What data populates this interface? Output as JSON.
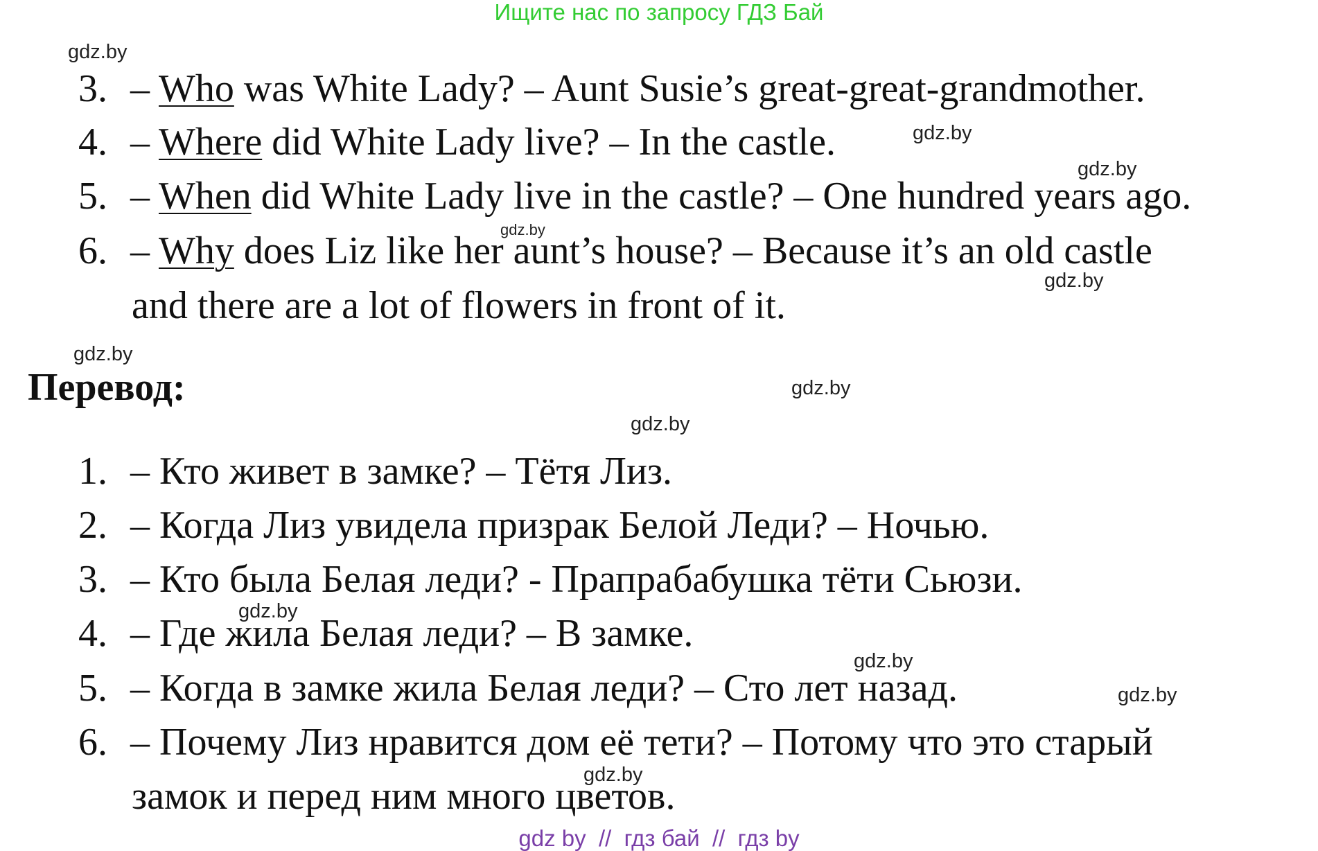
{
  "banner_top": "Ищите нас по запросу ГДЗ Бай",
  "banner_bottom": "gdz by  //  гдз бай  //  гдз by",
  "watermark": "gdz.by",
  "english": [
    {
      "num": "3.",
      "dash": "– ",
      "q": "Who",
      "rest": " was White Lady? – Aunt Susie’s great-great-grandmother."
    },
    {
      "num": "4.",
      "dash": "– ",
      "q": "Where",
      "rest": " did White Lady live? – In the castle."
    },
    {
      "num": "5.",
      "dash": "– ",
      "q": "When",
      "rest": " did White Lady live in the castle? – One hundred years ago."
    },
    {
      "num": "6.",
      "dash": "– ",
      "q": "Why",
      "rest": " does Liz like her aunt’s house? – Because it’s an old castle",
      "cont": "and there are a lot of flowers in front of it."
    }
  ],
  "heading": "Перевод:",
  "russian": [
    {
      "num": "1.",
      "text": "– Кто живет в замке? – Тётя Лиз."
    },
    {
      "num": "2.",
      "text": "– Когда Лиз увидела призрак Белой Леди? – Ночью."
    },
    {
      "num": "3.",
      "text": "– Кто была Белая леди? - Прапрабабушка тёти Сьюзи."
    },
    {
      "num": "4.",
      "text": "– Где жила Белая леди? – В замке."
    },
    {
      "num": "5.",
      "text": "– Когда в замке жила Белая леди? – Сто лет назад."
    },
    {
      "num": "6.",
      "text": "– Почему Лиз нравится дом её тети? – Потому что это старый",
      "cont": "замок и перед ним много цветов."
    }
  ],
  "colors": {
    "banner_top": "#33cc33",
    "banner_bottom": "#7a3fa8",
    "text": "#111111"
  }
}
